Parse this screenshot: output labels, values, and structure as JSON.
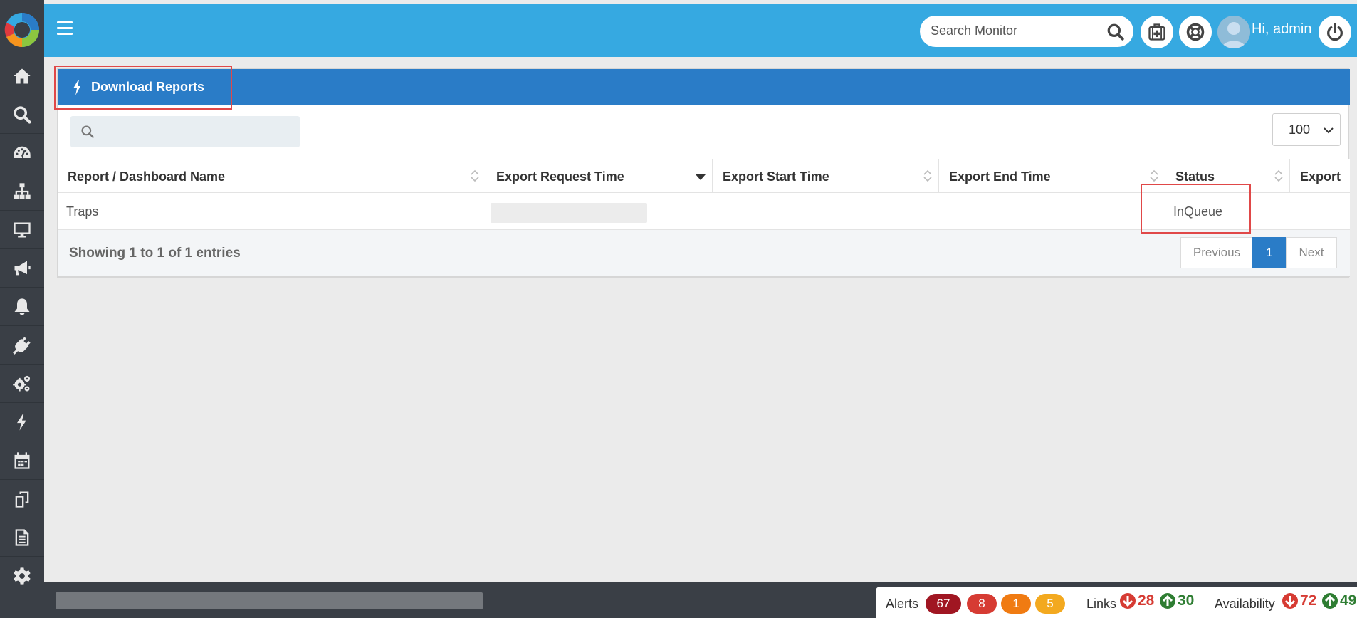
{
  "topbar": {
    "search_placeholder": "Search Monitor",
    "greeting": "Hi, admin"
  },
  "sidebar": {
    "items": [
      {
        "icon": "home-icon"
      },
      {
        "icon": "search-icon"
      },
      {
        "icon": "dashboard-icon"
      },
      {
        "icon": "sitemap-icon"
      },
      {
        "icon": "monitor-icon"
      },
      {
        "icon": "bullhorn-icon"
      },
      {
        "icon": "bell-icon"
      },
      {
        "icon": "plug-icon"
      },
      {
        "icon": "cogs-icon"
      },
      {
        "icon": "bolt-icon"
      },
      {
        "icon": "calendar-icon"
      },
      {
        "icon": "copy-icon"
      },
      {
        "icon": "document-icon"
      },
      {
        "icon": "settings-icon"
      }
    ]
  },
  "panel": {
    "title": "Download Reports",
    "page_size": "100",
    "columns": [
      "Report / Dashboard Name",
      "Export Request Time",
      "Export Start Time",
      "Export End Time",
      "Status",
      "Export"
    ],
    "rows": [
      {
        "name": "Traps",
        "request_time": "",
        "start_time": "",
        "end_time": "",
        "status": "InQueue",
        "export": ""
      }
    ],
    "info": "Showing 1 to 1 of 1 entries",
    "pagination": {
      "previous": "Previous",
      "current": "1",
      "next": "Next"
    }
  },
  "footer": {
    "alerts_label": "Alerts",
    "alert_counts": [
      {
        "value": "67",
        "color": "#a01622"
      },
      {
        "value": "8",
        "color": "#d63b33"
      },
      {
        "value": "1",
        "color": "#f07b12"
      },
      {
        "value": "5",
        "color": "#f3a91f"
      }
    ],
    "links_label": "Links",
    "links_down": "28",
    "links_up": "30",
    "availability_label": "Availability",
    "availability_down": "72",
    "availability_up": "49"
  },
  "colors": {
    "topbar": "#36a9e1",
    "panel_header": "#2a7cc7",
    "sidebar": "#3a3f46",
    "highlight": "#e04848",
    "down": "#d63b33",
    "up": "#2e7d32"
  }
}
